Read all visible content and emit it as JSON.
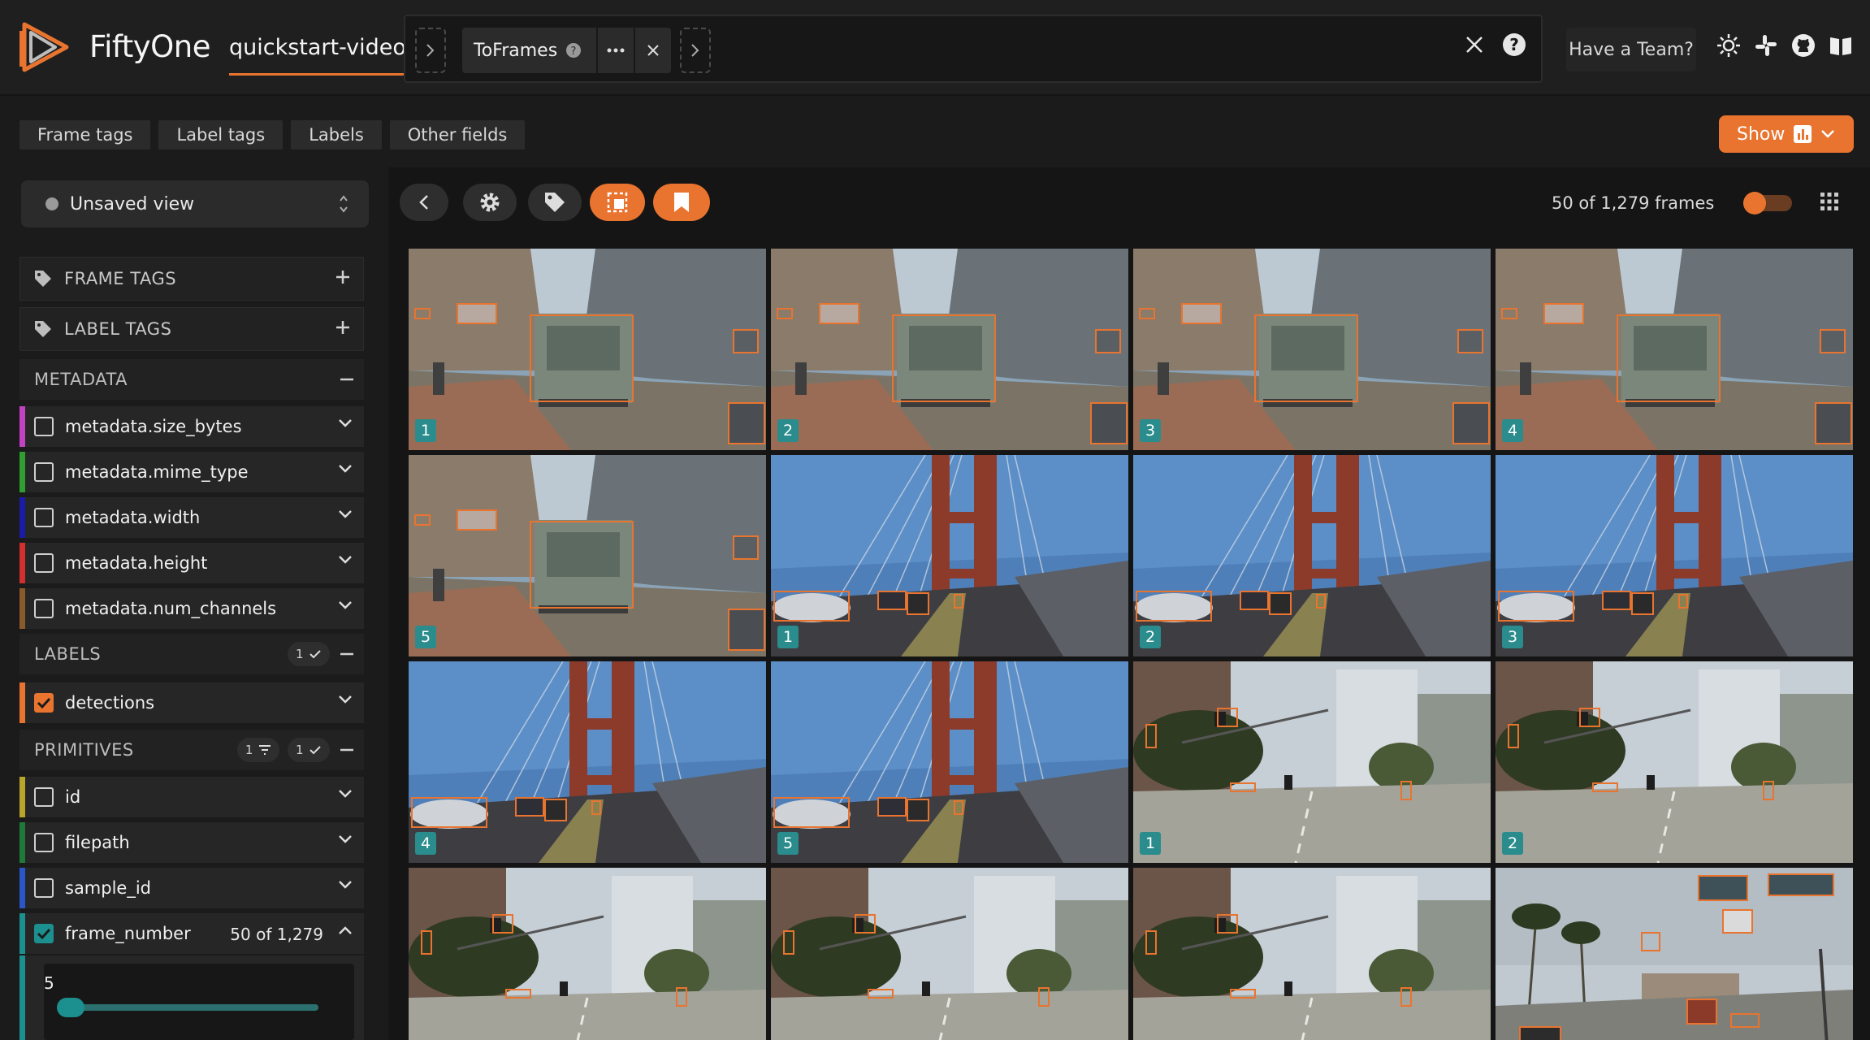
{
  "header": {
    "brand": "FiftyOne",
    "dataset": "quickstart-video",
    "stage": "ToFrames",
    "team_button": "Have a Team?"
  },
  "field_tabs": [
    "Frame tags",
    "Label tags",
    "Labels",
    "Other fields"
  ],
  "show_button": "Show",
  "sidebar": {
    "view_name": "Unsaved view",
    "groups": {
      "frame_tags": "FRAME TAGS",
      "label_tags": "LABEL TAGS",
      "metadata": "METADATA",
      "labels": "LABELS",
      "primitives": "PRIMITIVES"
    },
    "labels_count": "1",
    "primitives_filter_count": "1",
    "primitives_count": "1",
    "metadata_fields": [
      {
        "name": "metadata.size_bytes",
        "color": "#c341c3"
      },
      {
        "name": "metadata.mime_type",
        "color": "#2fa02f"
      },
      {
        "name": "metadata.width",
        "color": "#1b1baa"
      },
      {
        "name": "metadata.height",
        "color": "#d32f2f"
      },
      {
        "name": "metadata.num_channels",
        "color": "#8a5a2b"
      }
    ],
    "label_fields": [
      {
        "name": "detections",
        "color": "#e8742f",
        "checked": true
      }
    ],
    "primitive_fields": [
      {
        "name": "id",
        "color": "#b8a52a"
      },
      {
        "name": "filepath",
        "color": "#1f7a3a"
      },
      {
        "name": "sample_id",
        "color": "#2a56c9"
      },
      {
        "name": "frame_number",
        "color": "#1c8f8f",
        "checked": true,
        "count": "50 of 1,279"
      }
    ],
    "range_value": "5"
  },
  "grid": {
    "frames_count": "50 of 1,279 frames",
    "tiles": [
      {
        "scene": "truck",
        "frame": "1"
      },
      {
        "scene": "truck",
        "frame": "2"
      },
      {
        "scene": "truck",
        "frame": "3"
      },
      {
        "scene": "truck",
        "frame": "4"
      },
      {
        "scene": "truck",
        "frame": "5"
      },
      {
        "scene": "bridge",
        "frame": "1"
      },
      {
        "scene": "bridge",
        "frame": "2"
      },
      {
        "scene": "bridge",
        "frame": "3"
      },
      {
        "scene": "bridge",
        "frame": "4"
      },
      {
        "scene": "bridge",
        "frame": "5"
      },
      {
        "scene": "street",
        "frame": "1"
      },
      {
        "scene": "street",
        "frame": "2"
      },
      {
        "scene": "street",
        "frame": ""
      },
      {
        "scene": "street",
        "frame": ""
      },
      {
        "scene": "street",
        "frame": ""
      },
      {
        "scene": "palm",
        "frame": ""
      }
    ]
  },
  "colors": {
    "accent": "#e8742f",
    "teal": "#2a8c8c"
  },
  "icons": [
    "fiftyone-logo-icon",
    "chevron-right-icon",
    "help-icon",
    "more-icon",
    "close-icon",
    "sun-icon",
    "slack-icon",
    "github-icon",
    "docs-icon",
    "bar-chart-icon",
    "chevron-down-icon",
    "tag-icon",
    "plus-icon",
    "minus-icon",
    "check-icon",
    "filter-icon",
    "chevron-left-icon",
    "gear-icon",
    "patches-icon",
    "bookmark-icon",
    "grid-icon",
    "updown-icon"
  ]
}
